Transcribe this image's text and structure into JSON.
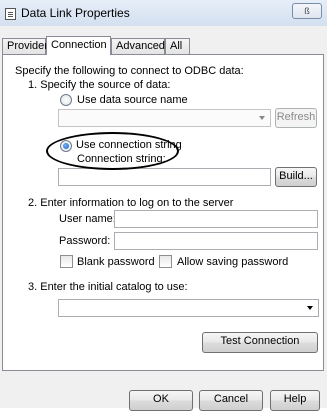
{
  "window": {
    "title": "Data Link Properties",
    "close_label": "ß"
  },
  "tabs": [
    {
      "label": "Provider"
    },
    {
      "label": "Connection"
    },
    {
      "label": "Advanced"
    },
    {
      "label": "All"
    }
  ],
  "connection": {
    "intro": "Specify the following to connect to ODBC data:",
    "step1": "1. Specify the source of data:",
    "use_dsn_label": "Use data source name",
    "dsn_value": "",
    "refresh_label": "Refresh",
    "use_connstr_label": "Use connection string",
    "connstr_label": "Connection string:",
    "connstr_value": "",
    "build_label": "Build...",
    "step2": "2. Enter information to log on to the server",
    "username_label": "User name:",
    "username_value": "",
    "password_label": "Password:",
    "password_value": "",
    "blank_password_label": "Blank password",
    "allow_saving_label": "Allow saving password",
    "step3": "3. Enter the initial catalog to use:",
    "catalog_value": "",
    "test_connection_label": "Test Connection"
  },
  "footer": {
    "ok_label": "OK",
    "cancel_label": "Cancel",
    "help_label": "Help"
  },
  "state": {
    "active_tab": "Connection",
    "selected_source": "Use connection string",
    "blank_password_checked": false,
    "allow_saving_checked": false
  }
}
